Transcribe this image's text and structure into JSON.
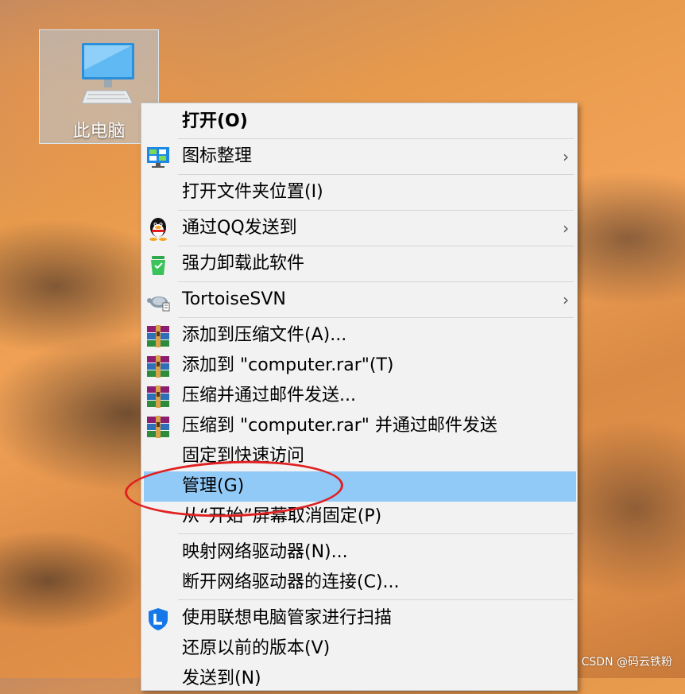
{
  "desktop": {
    "icon_label": "此电脑"
  },
  "context_menu": {
    "items": [
      {
        "label": "打开(O)",
        "bold": true
      },
      {
        "label": "图标整理",
        "icon": "desktop-organize-icon",
        "submenu": true
      },
      {
        "label": "打开文件夹位置(I)"
      },
      {
        "label": "通过QQ发送到",
        "icon": "qq-penguin-icon",
        "submenu": true
      },
      {
        "label": "强力卸载此软件",
        "icon": "uninstall-bin-icon"
      },
      {
        "label": "TortoiseSVN",
        "icon": "tortoise-svn-icon",
        "submenu": true
      },
      {
        "label": "添加到压缩文件(A)...",
        "icon": "winrar-books-icon"
      },
      {
        "label": "添加到 \"computer.rar\"(T)",
        "icon": "winrar-books-icon"
      },
      {
        "label": "压缩并通过邮件发送...",
        "icon": "winrar-books-icon"
      },
      {
        "label": "压缩到 \"computer.rar\" 并通过邮件发送",
        "icon": "winrar-books-icon"
      },
      {
        "label": "固定到快速访问"
      },
      {
        "label": "管理(G)",
        "highlighted": true
      },
      {
        "label": "从“开始”屏幕取消固定(P)"
      },
      {
        "label": "映射网络驱动器(N)..."
      },
      {
        "label": "断开网络驱动器的连接(C)..."
      },
      {
        "label": "使用联想电脑管家进行扫描",
        "icon": "lenovo-shield-icon"
      },
      {
        "label": "还原以前的版本(V)"
      },
      {
        "label": "发送到(N)"
      }
    ],
    "submenu_glyph": "›",
    "highlight_color": "#91c9f7"
  },
  "annotation": {
    "color": "#e02020"
  },
  "watermark": "CSDN @码云铁粉"
}
